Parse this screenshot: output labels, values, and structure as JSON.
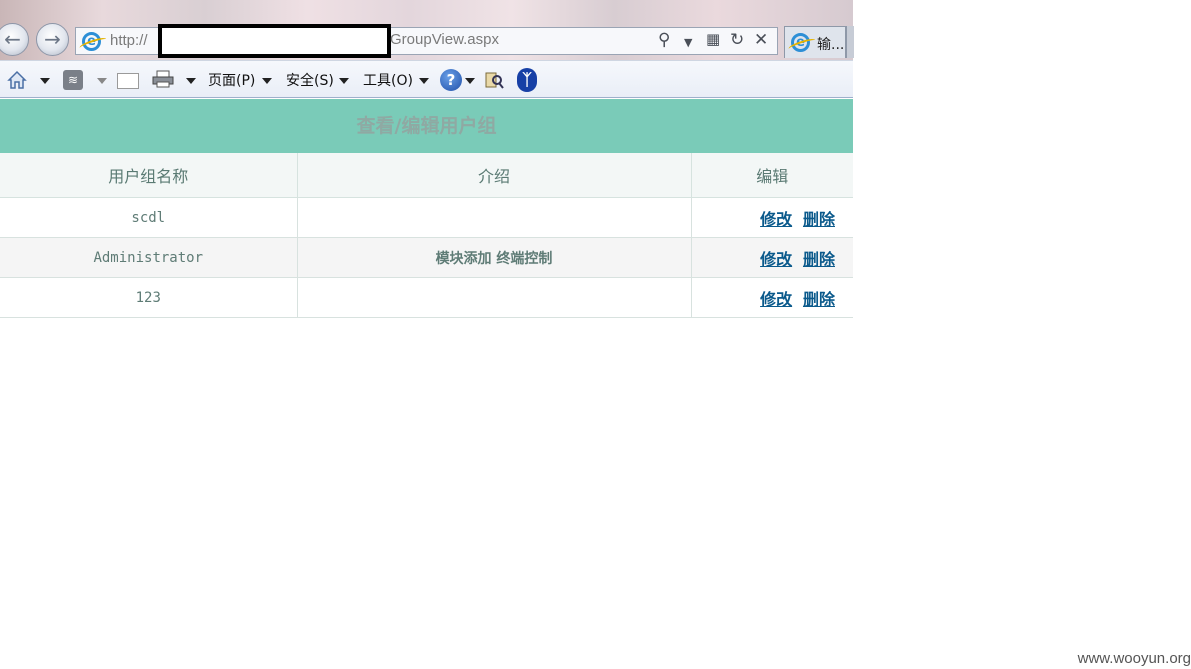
{
  "browser": {
    "url_scheme": "http://",
    "url_path": "GroupView.aspx",
    "tab_label": "输...",
    "menu": {
      "page": "页面(P)",
      "security": "安全(S)",
      "tools": "工具(O)"
    }
  },
  "page": {
    "title": "查看/编辑用户组",
    "columns": [
      "用户组名称",
      "介绍",
      "编辑"
    ],
    "rows": [
      {
        "name": "scdl",
        "desc": "",
        "edit": "修改",
        "delete": "删除"
      },
      {
        "name": "Administrator",
        "desc": "模块添加 终端控制",
        "edit": "修改",
        "delete": "删除"
      },
      {
        "name": "123",
        "desc": "",
        "edit": "修改",
        "delete": "删除"
      }
    ]
  },
  "watermark": "www.wooyun.org"
}
